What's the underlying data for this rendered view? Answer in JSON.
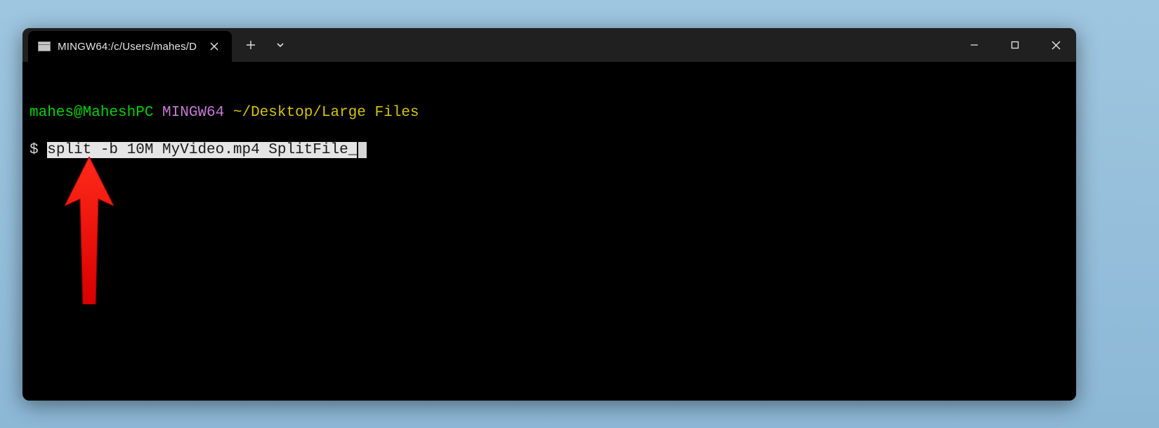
{
  "tab": {
    "title": "MINGW64:/c/Users/mahes/D"
  },
  "prompt": {
    "user_host": "mahes@MaheshPC",
    "env": "MINGW64",
    "path": "~/Desktop/Large Files",
    "symbol": "$",
    "command": "split -b 10M MyVideo.mp4 SplitFile_"
  }
}
